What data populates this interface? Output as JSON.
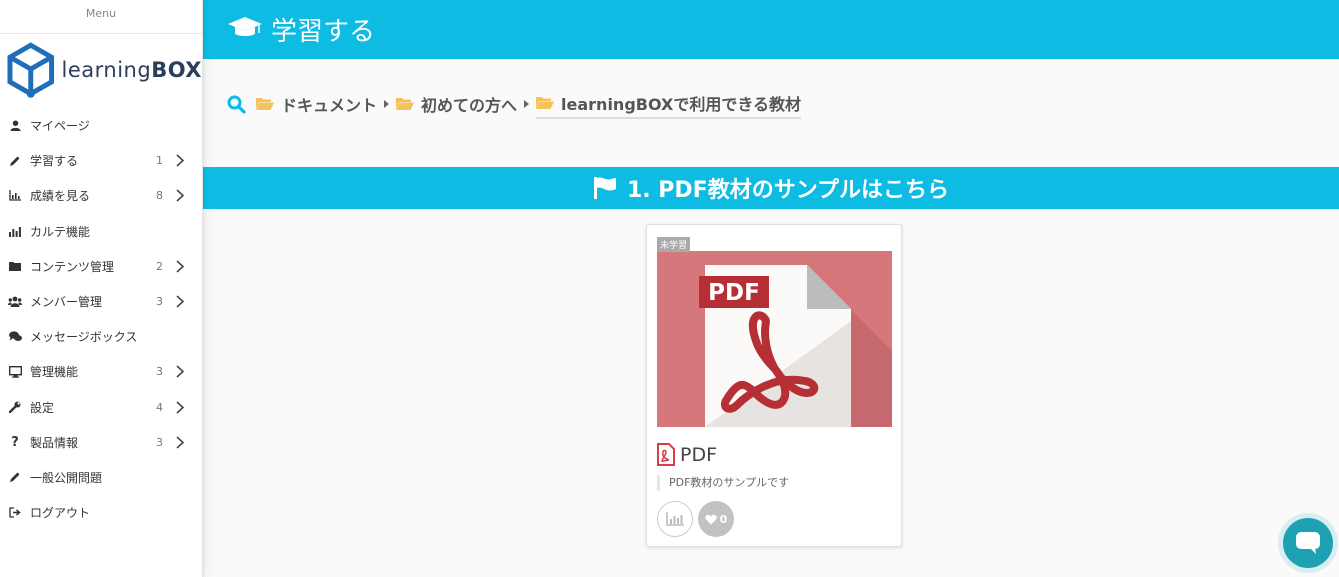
{
  "sidebar": {
    "menu_title": "Menu",
    "logo": {
      "text_light": "learning",
      "text_bold": "BOX"
    },
    "items": [
      {
        "label": "マイページ",
        "icon": "user-icon",
        "count": ""
      },
      {
        "label": "学習する",
        "icon": "pencil-icon",
        "count": "1"
      },
      {
        "label": "成績を見る",
        "icon": "chart-area-icon",
        "count": "8"
      },
      {
        "label": "カルテ機能",
        "icon": "chart-bars-icon",
        "count": ""
      },
      {
        "label": "コンテンツ管理",
        "icon": "folder-icon",
        "count": "2"
      },
      {
        "label": "メンバー管理",
        "icon": "users-icon",
        "count": "3"
      },
      {
        "label": "メッセージボックス",
        "icon": "comments-icon",
        "count": ""
      },
      {
        "label": "管理機能",
        "icon": "desktop-icon",
        "count": "3"
      },
      {
        "label": "設定",
        "icon": "wrench-icon",
        "count": "4"
      },
      {
        "label": "製品情報",
        "icon": "question-icon",
        "count": "3"
      },
      {
        "label": "一般公開問題",
        "icon": "pencil-icon",
        "count": ""
      },
      {
        "label": "ログアウト",
        "icon": "sign-out-icon",
        "count": ""
      }
    ]
  },
  "header": {
    "title": "学習する",
    "icon": "graduation-cap-icon"
  },
  "breadcrumb": {
    "items": [
      {
        "label": "ドキュメント"
      },
      {
        "label": "初めての方へ"
      },
      {
        "label": "learningBOXで利用できる教材"
      }
    ]
  },
  "section": {
    "title": "1. PDF教材のサンプルはこちら",
    "icon": "flag-icon"
  },
  "card": {
    "badge": "未学習",
    "thumb_label": "PDF",
    "title": "PDF",
    "description": "PDF教材のサンプルです",
    "like_count": "0"
  },
  "colors": {
    "accent": "#0dbbe3",
    "thumb_bg": "#d5777b",
    "pdf_red": "#b52f35",
    "chat": "#1ea1b3"
  }
}
